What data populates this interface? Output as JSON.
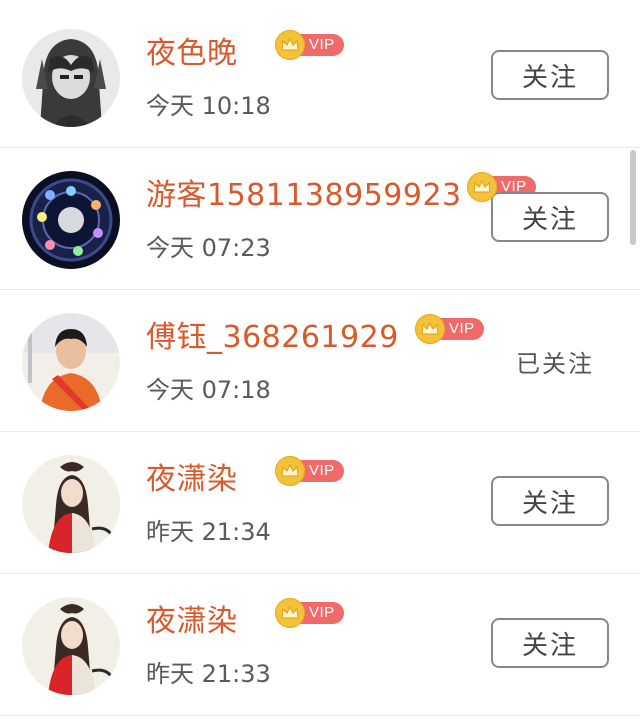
{
  "users": [
    {
      "name": "夜色晚",
      "vip_label": "VIP",
      "time": "今天 10:18",
      "action": "关注",
      "followed": false
    },
    {
      "name": "游客1581138959923",
      "vip_label": "VIP",
      "time": "今天 07:23",
      "action": "关注",
      "followed": false
    },
    {
      "name": "傅钰_368261929",
      "vip_label": "VIP",
      "time": "今天 07:18",
      "action": "已关注",
      "followed": true
    },
    {
      "name": "夜潇染",
      "vip_label": "VIP",
      "time": "昨天 21:34",
      "action": "关注",
      "followed": false
    },
    {
      "name": "夜潇染",
      "vip_label": "VIP",
      "time": "昨天 21:33",
      "action": "关注",
      "followed": false
    }
  ],
  "colors": {
    "name": "#d85a2c",
    "vip_badge": "#f06a6a",
    "crown": "#f4c23a",
    "button_border": "#888888"
  },
  "icons": [
    "crown-icon"
  ]
}
